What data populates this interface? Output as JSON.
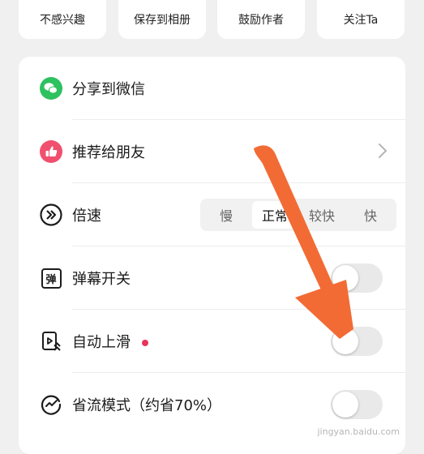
{
  "top_actions": [
    {
      "label": "不感兴趣"
    },
    {
      "label": "保存到相册"
    },
    {
      "label": "鼓励作者"
    },
    {
      "label": "关注Ta"
    }
  ],
  "menu": {
    "share_wechat": {
      "label": "分享到微信",
      "icon": "wechat-icon",
      "color": "#2dc15f"
    },
    "recommend": {
      "label": "推荐给朋友",
      "icon": "thumbs-up-icon",
      "color": "#f0506e"
    },
    "speed": {
      "label": "倍速",
      "icon": "fast-forward-icon",
      "options": [
        "慢",
        "正常",
        "较快",
        "快"
      ],
      "selected": "正常"
    },
    "danmaku": {
      "label": "弹幕开关",
      "icon": "danmaku-icon",
      "icon_text": "弹",
      "on": false
    },
    "autoplay": {
      "label": "自动上滑",
      "icon": "auto-swipe-icon",
      "on": false,
      "has_new_dot": true
    },
    "data_saver": {
      "label": "省流模式（约省70%）",
      "icon": "data-saver-icon",
      "on": false
    }
  },
  "annotation": {
    "color": "#f26b35"
  },
  "watermark": "jingyan.baidu.com"
}
